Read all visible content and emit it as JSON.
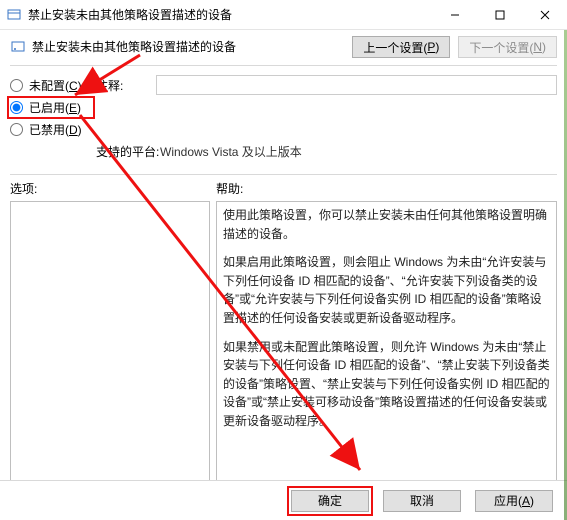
{
  "titlebar": {
    "title": "禁止安装未由其他策略设置描述的设备"
  },
  "subheader": {
    "title": "禁止安装未由其他策略设置描述的设备"
  },
  "nav": {
    "prev_label": "上一个设置(",
    "prev_key": "P",
    "prev_suffix": ")",
    "next_label": "下一个设置(",
    "next_key": "N",
    "next_suffix": ")"
  },
  "radios": {
    "not_configured": {
      "label": "未配置(",
      "key": "C",
      "suffix": ")",
      "checked": false
    },
    "enabled": {
      "label": "已启用(",
      "key": "E",
      "suffix": ")",
      "checked": true
    },
    "disabled": {
      "label": "已禁用(",
      "key": "D",
      "suffix": ")",
      "checked": false
    }
  },
  "fields": {
    "comment_label": "注释:",
    "comment_value": "",
    "platform_label": "支持的平台:",
    "platform_value": "Windows Vista 及以上版本"
  },
  "panels": {
    "options_label": "选项:",
    "help_label": "帮助:"
  },
  "help": {
    "p1": "使用此策略设置，你可以禁止安装未由任何其他策略设置明确描述的设备。",
    "p2": "如果启用此策略设置，则会阻止 Windows 为未由“允许安装与下列任何设备 ID 相匹配的设备”、“允许安装下列设备类的设备”或“允许安装与下列任何设备实例 ID 相匹配的设备”策略设置描述的任何设备安装或更新设备驱动程序。",
    "p3": "如果禁用或未配置此策略设置，则允许 Windows 为未由“禁止安装与下列任何设备 ID 相匹配的设备”、“禁止安装下列设备类的设备”策略设置、“禁止安装与下列任何设备实例 ID 相匹配的设备”或“禁止安装可移动设备”策略设置描述的任何设备安装或更新设备驱动程序。"
  },
  "buttons": {
    "ok": {
      "label": "确定"
    },
    "cancel": {
      "label": "取消"
    },
    "apply": {
      "label": "应用(",
      "key": "A",
      "suffix": ")"
    }
  }
}
